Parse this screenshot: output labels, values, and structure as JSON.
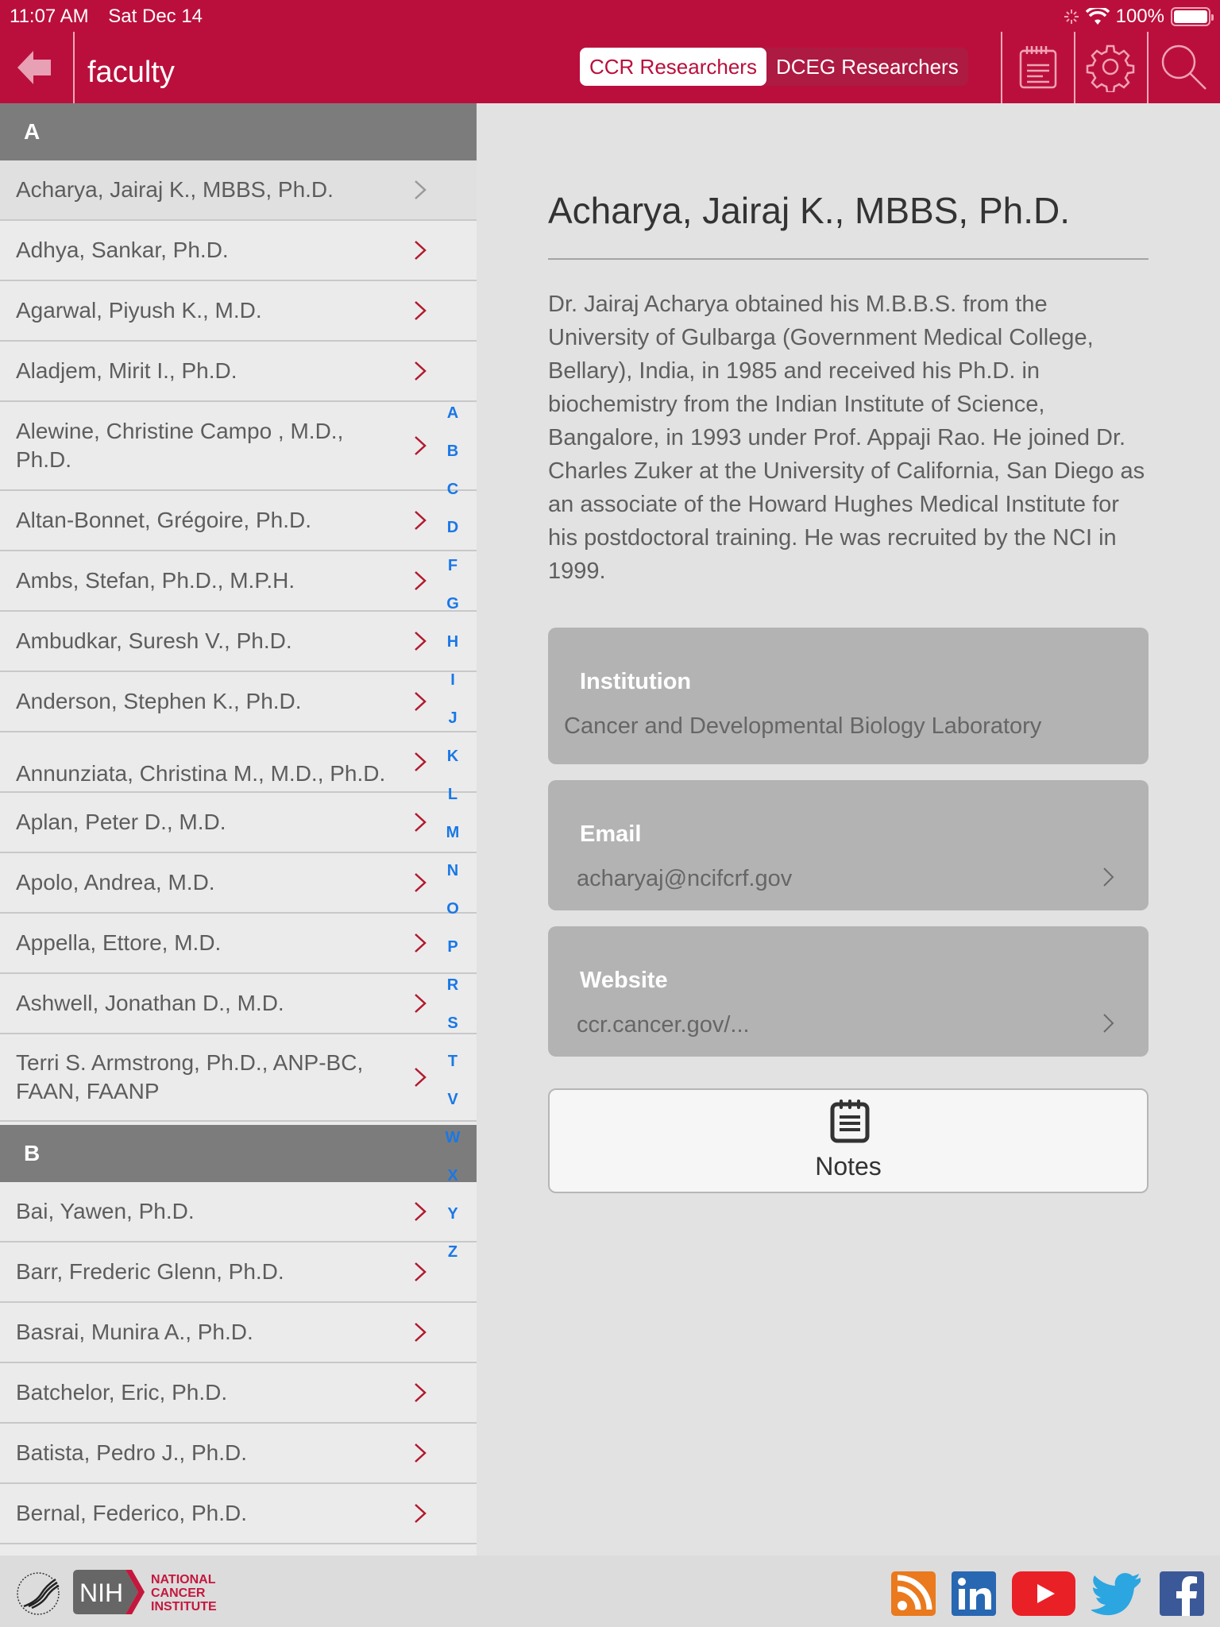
{
  "status_bar": {
    "time": "11:07 AM",
    "date": "Sat Dec 14",
    "battery": "100%"
  },
  "header": {
    "title": "faculty",
    "segments": [
      {
        "label": "CCR Researchers",
        "active": true
      },
      {
        "label": "DCEG Researchers",
        "active": false
      }
    ],
    "icons": [
      "back-arrow-icon",
      "notepad-icon",
      "gear-icon",
      "search-icon"
    ]
  },
  "sidebar": {
    "sections": [
      {
        "letter": "A",
        "items": [
          "Acharya, Jairaj K., MBBS, Ph.D.",
          "Adhya, Sankar, Ph.D.",
          "Agarwal, Piyush K.,  M.D.",
          "Aladjem, Mirit I., Ph.D.",
          "Alewine, Christine Campo , M.D., Ph.D.",
          "Altan-Bonnet, Grégoire, Ph.D.",
          "Ambs, Stefan, Ph.D., M.P.H.",
          "Ambudkar, Suresh V., Ph.D.",
          "Anderson, Stephen K., Ph.D.",
          "Annunziata, Christina M., M.D., Ph.D.",
          "Aplan, Peter D., M.D.",
          "Apolo, Andrea, M.D.",
          "Appella, Ettore, M.D.",
          "Ashwell, Jonathan D., M.D.",
          "Terri S. Armstrong, Ph.D., ANP-BC, FAAN, FAANP"
        ]
      },
      {
        "letter": "B",
        "items": [
          "Bai, Yawen, Ph.D.",
          "Barr, Frederic Glenn, Ph.D.",
          "Basrai, Munira A., Ph.D.",
          "Batchelor, Eric, Ph.D.",
          "Batista, Pedro J., Ph.D.",
          "Bernal, Federico, Ph.D."
        ]
      }
    ],
    "selected_index": 0,
    "index_letters": [
      "A",
      "B",
      "C",
      "D",
      "F",
      "G",
      "H",
      "I",
      "J",
      "K",
      "L",
      "M",
      "N",
      "O",
      "P",
      "R",
      "S",
      "T",
      "V",
      "W",
      "X",
      "Y",
      "Z"
    ]
  },
  "detail": {
    "name": "Acharya, Jairaj K., MBBS, Ph.D.",
    "bio": "Dr. Jairaj Acharya obtained his M.B.B.S. from the University of Gulbarga (Government Medical College, Bellary), India, in 1985 and received his Ph.D. in biochemistry from the Indian Institute of Science, Bangalore, in 1993 under Prof. Appaji Rao. He joined Dr. Charles Zuker at the University of California, San Diego as an associate of the Howard Hughes Medical Institute for his postdoctoral training. He was recruited by the NCI in 1999.",
    "institution": {
      "label": "Institution",
      "value": "Cancer and Developmental Biology Laboratory"
    },
    "email": {
      "label": "Email",
      "value": "acharyaj@ncifcrf.gov"
    },
    "website": {
      "label": "Website",
      "value": "ccr.cancer.gov/..."
    },
    "notes_label": "Notes"
  },
  "footer": {
    "logo_nih": "NIH",
    "logo_nci": [
      "NATIONAL",
      "CANCER",
      "INSTITUTE"
    ],
    "social": [
      "rss",
      "linkedin",
      "youtube",
      "twitter",
      "facebook"
    ]
  },
  "colors": {
    "brand": "#ba0f3c",
    "index_blue": "#1978e6",
    "chevron_red": "#b21a2e"
  }
}
